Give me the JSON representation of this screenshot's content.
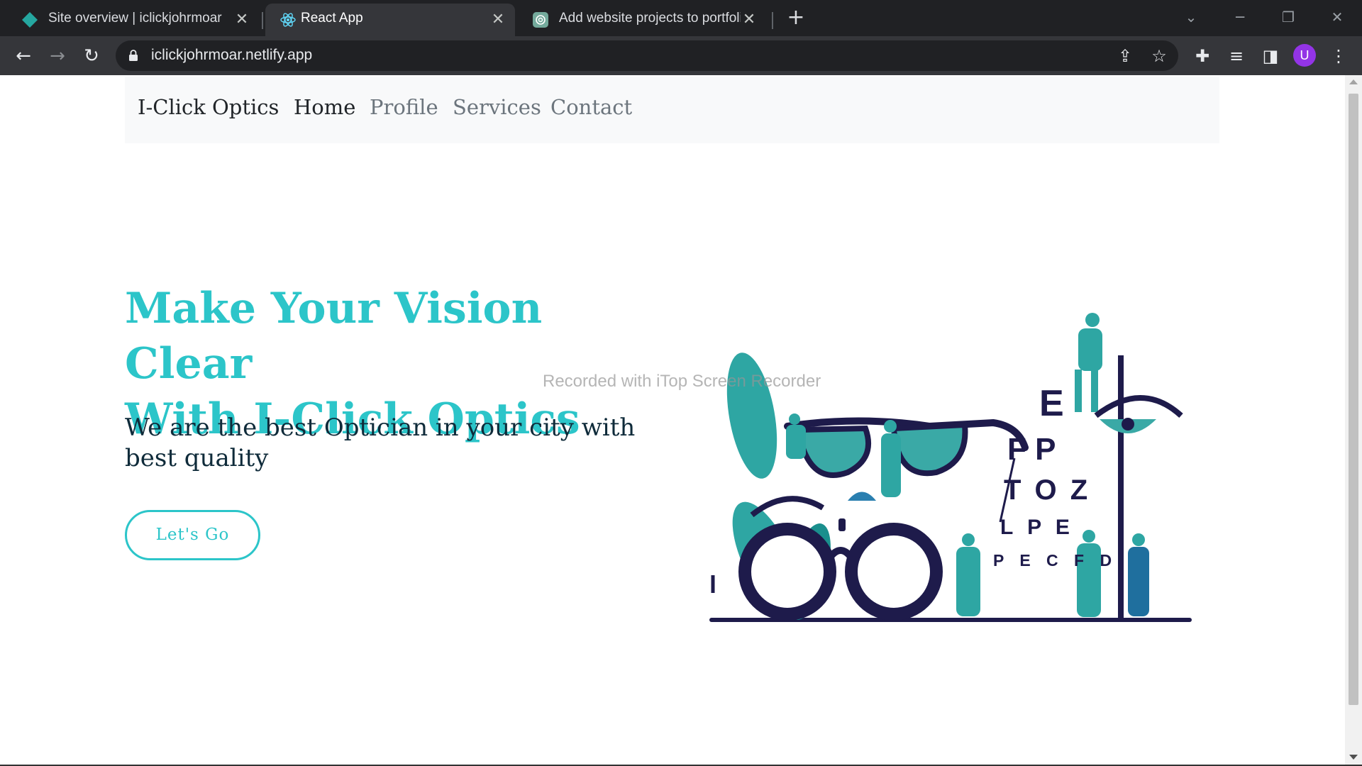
{
  "browser": {
    "tabs": [
      {
        "title": "Site overview | iclickjohrmoar",
        "favicon": "netlify-diamond-icon",
        "active": false
      },
      {
        "title": "React App",
        "favicon": "react-atom-icon",
        "active": true
      },
      {
        "title": "Add website projects to portfolio",
        "favicon": "chatgpt-knot-icon",
        "active": false
      }
    ],
    "address": "iclickjohrmoar.netlify.app",
    "avatar_letter": "U",
    "accent": "#9334e6"
  },
  "site": {
    "brand": "I-Click Optics",
    "nav": [
      {
        "label": "Home",
        "active": true
      },
      {
        "label": "Profile",
        "active": false
      },
      {
        "label": "Services",
        "active": false
      },
      {
        "label": "Contact",
        "active": false
      }
    ],
    "hero": {
      "title_line1": "Make Your Vision Clear",
      "title_line2": "With I-Click Optics",
      "subtitle": "We are the best Optician in your city with best quality",
      "cta": "Let's Go"
    },
    "watermark": "Recorded with iTop Screen Recorder",
    "eye_chart": {
      "row1": "E",
      "row2": "F P",
      "row3": "T O Z",
      "row4": "L P E",
      "row5": "P E C F D"
    },
    "colors": {
      "teal": "#2cc5c9",
      "navy": "#1e1b4b",
      "text": "#0f2b3a"
    }
  }
}
